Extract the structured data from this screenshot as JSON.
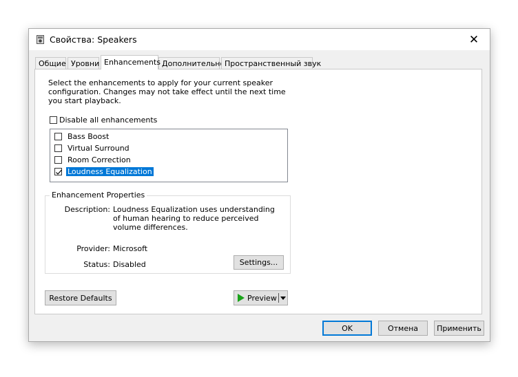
{
  "window": {
    "title": "Свойства: Speakers",
    "close_glyph": "✕"
  },
  "tabs": [
    {
      "label": "Общие"
    },
    {
      "label": "Уровни"
    },
    {
      "label": "Enhancements"
    },
    {
      "label": "Дополнительно"
    },
    {
      "label": "Пространственный звук"
    }
  ],
  "active_tab": "Enhancements",
  "enhancements": {
    "description": "Select the enhancements to apply for your current speaker configuration. Changes may not take effect until the next time you start playback.",
    "disable_all": {
      "label": "Disable all enhancements",
      "checked": false
    },
    "items": [
      {
        "label": "Bass Boost",
        "checked": false
      },
      {
        "label": "Virtual Surround",
        "checked": false
      },
      {
        "label": "Room Correction",
        "checked": false
      },
      {
        "label": "Loudness Equalization",
        "checked": true,
        "selected": true
      }
    ]
  },
  "properties": {
    "group_title": "Enhancement Properties",
    "description_label": "Description:",
    "description_value": "Loudness Equalization uses understanding of human hearing to reduce perceived volume differences.",
    "provider_label": "Provider:",
    "provider_value": "Microsoft",
    "status_label": "Status:",
    "status_value": "Disabled",
    "settings_button": "Settings..."
  },
  "bottom": {
    "restore_defaults": "Restore Defaults",
    "preview": "Preview"
  },
  "footer": {
    "ok": "OK",
    "cancel": "Отмена",
    "apply": "Применить"
  },
  "colors": {
    "accent": "#0078d7",
    "preview_play": "#1aa31a"
  },
  "icons": {
    "app": "speaker-icon",
    "close": "close-icon",
    "play": "play-icon",
    "dropdown": "chevron-down-icon",
    "check": "checkmark-icon"
  }
}
